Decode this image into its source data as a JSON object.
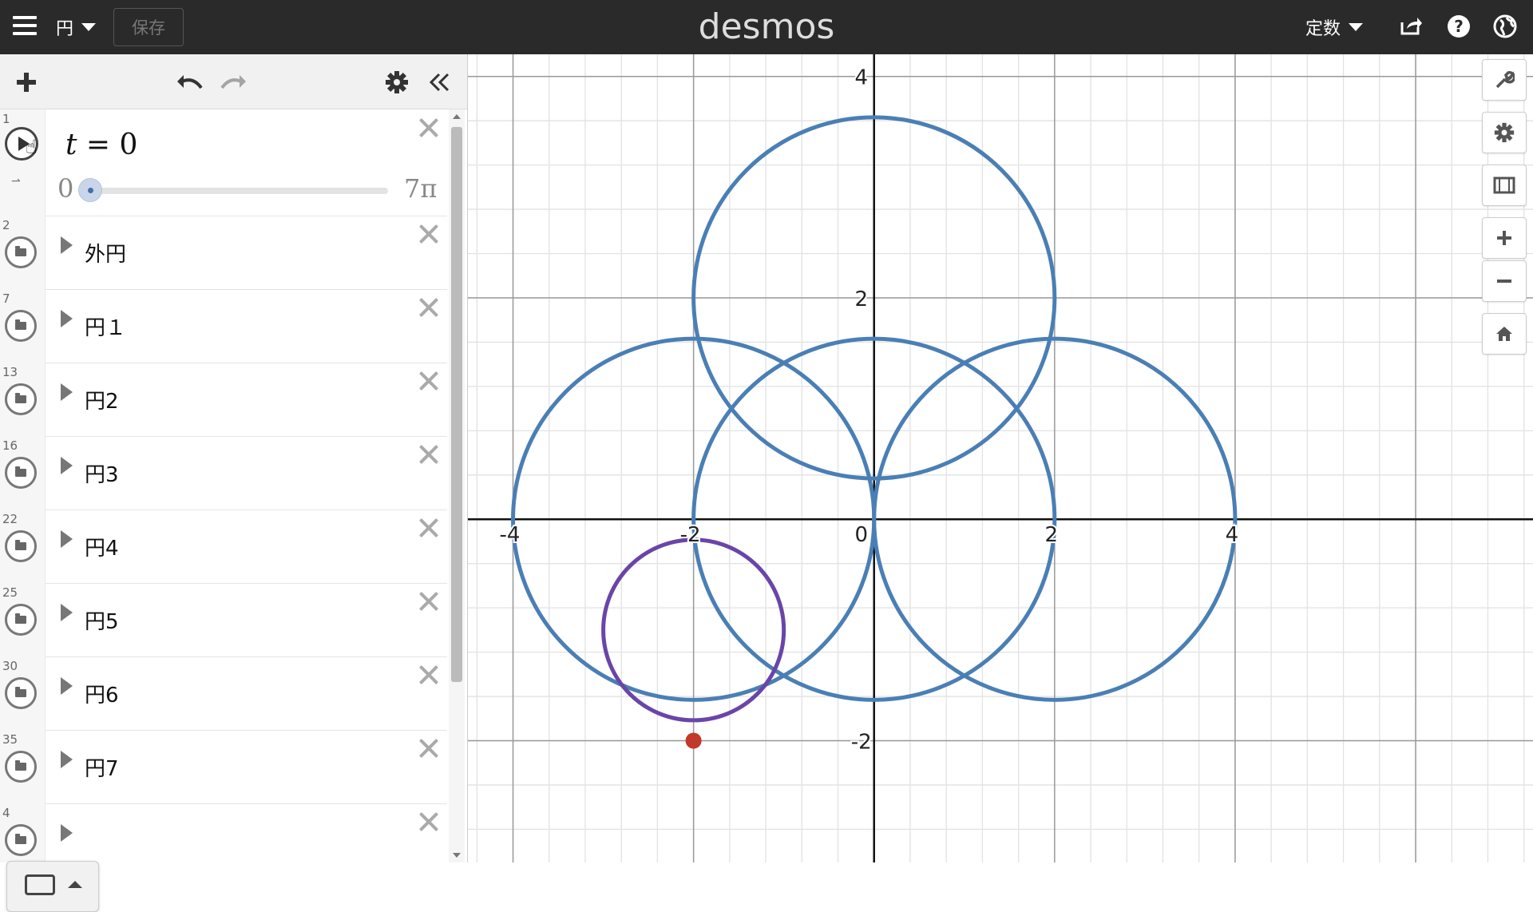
{
  "topbar": {
    "graph_title": "円",
    "save_label": "保存",
    "logo": "desmos",
    "mode_label": "定数"
  },
  "expressions": {
    "slider": {
      "number": "1",
      "variable": "t",
      "equals": "=",
      "value": "0",
      "min_label": "0",
      "max_label": "7π",
      "value_fraction": 0
    },
    "folders": [
      {
        "number": "2",
        "label": "外円"
      },
      {
        "number": "7",
        "label": "円１"
      },
      {
        "number": "13",
        "label": "円2"
      },
      {
        "number": "16",
        "label": "円3"
      },
      {
        "number": "22",
        "label": "円4"
      },
      {
        "number": "25",
        "label": "円5"
      },
      {
        "number": "30",
        "label": "円6"
      },
      {
        "number": "35",
        "label": "円7"
      },
      {
        "number": "4",
        "label": ""
      }
    ]
  },
  "chart_data": {
    "type": "scatter",
    "xlim": [
      -4.5,
      7.3
    ],
    "ylim": [
      -3.1,
      4.2
    ],
    "grid": true,
    "x_ticks": [
      "-4",
      "-2",
      "0",
      "2",
      "4"
    ],
    "y_ticks": [
      "4",
      "2",
      "-2"
    ],
    "circles": [
      {
        "cx": 0,
        "cy": 2,
        "r": 2,
        "color": "#4a7fb5"
      },
      {
        "cx": -2,
        "cy": 0,
        "r": 2,
        "color": "#4a7fb5"
      },
      {
        "cx": 0,
        "cy": 0,
        "r": 2,
        "color": "#4a7fb5"
      },
      {
        "cx": 2,
        "cy": 0,
        "r": 2,
        "color": "#4a7fb5"
      },
      {
        "cx": -2,
        "cy": -1,
        "r": 1,
        "color": "#6a45a8"
      }
    ],
    "points": [
      {
        "x": -2,
        "y": -2,
        "color": "#c0392b"
      }
    ]
  }
}
